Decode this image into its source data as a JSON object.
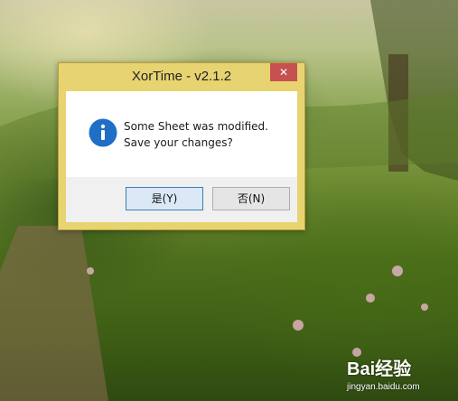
{
  "dialog": {
    "title": "XorTime - v2.1.2",
    "close_glyph": "✕",
    "icon": "info-icon",
    "message_line1": "Some Sheet was modified.",
    "message_line2": "Save your changes?",
    "buttons": {
      "yes": "是(Y)",
      "no": "否(N)"
    }
  },
  "watermark": {
    "brand": "Bai经验",
    "site": "jingyan.baidu.com"
  },
  "colors": {
    "title_bar": "#e8d371",
    "close_button": "#c75050",
    "info_icon": "#1f6fc6",
    "yes_focus_border": "#3c7fb1"
  }
}
